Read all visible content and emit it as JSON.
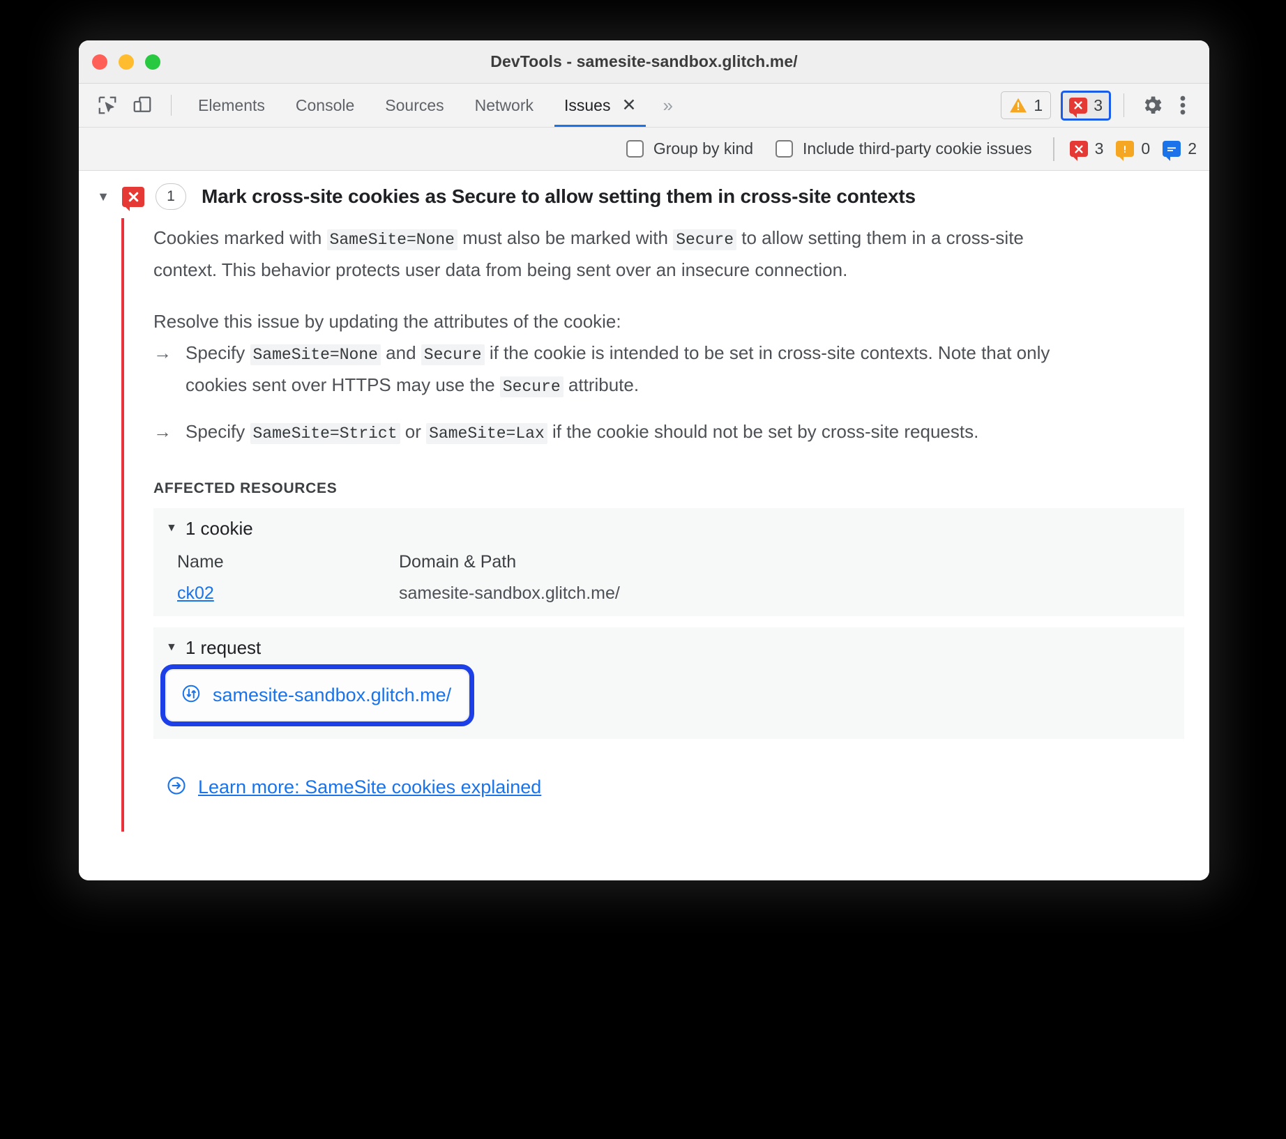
{
  "window": {
    "title": "DevTools - samesite-sandbox.glitch.me/",
    "traffic_lights": [
      "close",
      "minimize",
      "zoom"
    ]
  },
  "toolbar": {
    "inspect_icon": "inspect-cursor-icon",
    "device_icon": "device-toolbar-icon",
    "tabs": [
      {
        "label": "Elements",
        "active": false
      },
      {
        "label": "Console",
        "active": false
      },
      {
        "label": "Sources",
        "active": false
      },
      {
        "label": "Network",
        "active": false
      },
      {
        "label": "Issues",
        "active": true,
        "closable": true
      }
    ],
    "overflow_label": "»",
    "warning_count": "1",
    "error_count": "3",
    "settings_icon": "gear-icon",
    "more_icon": "kebab-menu-icon"
  },
  "filterbar": {
    "group_by_kind": {
      "label": "Group by kind",
      "checked": false
    },
    "include_third_party": {
      "label": "Include third-party cookie issues",
      "checked": false
    },
    "counts": {
      "errors": "3",
      "warnings": "0",
      "info": "2"
    }
  },
  "issue": {
    "expanded": true,
    "severity_icon": "error-bubble-icon",
    "count_chip": "1",
    "title": "Mark cross-site cookies as Secure to allow setting them in cross-site contexts",
    "paragraph1": {
      "part1": "Cookies marked with ",
      "code1": "SameSite=None",
      "part2": " must also be marked with ",
      "code2": "Secure",
      "part3": " to allow setting them in a cross-site context. This behavior protects user data from being sent over an insecure connection."
    },
    "paragraph2": "Resolve this issue by updating the attributes of the cookie:",
    "bullets": [
      {
        "arrow": "→",
        "part1": "Specify ",
        "code1": "SameSite=None",
        "part2": " and ",
        "code2": "Secure",
        "part3": " if the cookie is intended to be set in cross-site contexts. Note that only cookies sent over HTTPS may use the ",
        "code3": "Secure",
        "part4": " attribute."
      },
      {
        "arrow": "→",
        "part1": "Specify ",
        "code1": "SameSite=Strict",
        "part2": " or ",
        "code2": "SameSite=Lax",
        "part3": " if the cookie should not be set by cross-site requests.",
        "code3": "",
        "part4": ""
      }
    ],
    "affected_resources_label": "AFFECTED RESOURCES",
    "cookies_section": {
      "header": "1 cookie",
      "expanded": true,
      "columns": [
        "Name",
        "Domain & Path"
      ],
      "rows": [
        {
          "name": "ck02",
          "domain_path": "samesite-sandbox.glitch.me/"
        }
      ]
    },
    "requests_section": {
      "header": "1 request",
      "expanded": true,
      "rows": [
        {
          "icon": "network-request-icon",
          "url": "samesite-sandbox.glitch.me/"
        }
      ]
    },
    "learn_more": {
      "icon": "arrow-circle-right-icon",
      "label": "Learn more: SameSite cookies explained"
    }
  },
  "colors": {
    "error_red": "#e53935",
    "warning_amber": "#f5a623",
    "info_blue": "#1a73e8",
    "link_blue": "#1a73e8",
    "annotation_blue": "#1d3fe8",
    "issue_accent_line": "#e8323c"
  }
}
